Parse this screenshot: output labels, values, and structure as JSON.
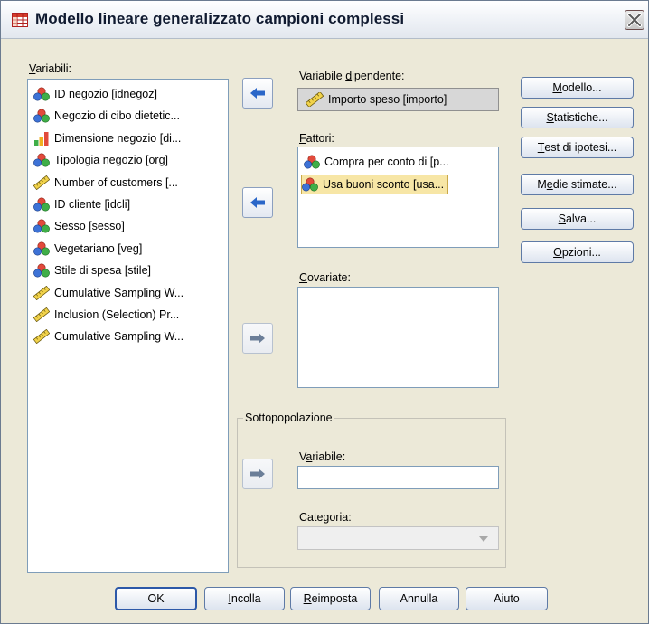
{
  "window": {
    "title": "Modello lineare generalizzato campioni complessi",
    "title_icon": "table-grid-icon",
    "close_icon": "close-icon"
  },
  "variables": {
    "label_u": "V",
    "label_rest": "ariabili:",
    "items": [
      {
        "label": "ID negozio [idnegoz]",
        "icon": "nominal-icon"
      },
      {
        "label": "Negozio di cibo dietetic...",
        "icon": "nominal-icon"
      },
      {
        "label": "Dimensione negozio [di...",
        "icon": "ordinal-icon"
      },
      {
        "label": "Tipologia negozio [org]",
        "icon": "nominal-icon"
      },
      {
        "label": "Number of customers [...",
        "icon": "scale-ruler-icon"
      },
      {
        "label": "ID cliente [idcli]",
        "icon": "nominal-icon"
      },
      {
        "label": "Sesso [sesso]",
        "icon": "nominal-icon"
      },
      {
        "label": "Vegetariano [veg]",
        "icon": "nominal-icon"
      },
      {
        "label": "Stile di spesa [stile]",
        "icon": "nominal-icon"
      },
      {
        "label": "Cumulative Sampling W...",
        "icon": "scale-ruler-icon"
      },
      {
        "label": "Inclusion (Selection) Pr...",
        "icon": "scale-ruler-icon"
      },
      {
        "label": "Cumulative Sampling W...",
        "icon": "scale-ruler-icon"
      }
    ]
  },
  "dependent": {
    "label_pre": "Variabile ",
    "label_u": "d",
    "label_post": "ipendente:",
    "value": "Importo speso [importo]",
    "icon": "scale-ruler-icon"
  },
  "factors": {
    "label_u": "F",
    "label_rest": "attori:",
    "items": [
      {
        "label": "Compra per conto di [p...",
        "icon": "nominal-icon",
        "selected": false
      },
      {
        "label": "Usa buoni sconto [usa...",
        "icon": "nominal-icon",
        "selected": true
      }
    ]
  },
  "covariates": {
    "label_u": "C",
    "label_rest": "ovariate:"
  },
  "subpopulation": {
    "legend": "Sottopopolazione",
    "variable_label_pre": "V",
    "variable_label_u": "a",
    "variable_label_post": "riabile:",
    "variable_value": "",
    "category_label_pre": "Cate",
    "category_label_u": "g",
    "category_label_post": "oria:",
    "category_value": ""
  },
  "side_buttons": [
    {
      "pre": "",
      "u": "M",
      "post": "odello..."
    },
    {
      "pre": "",
      "u": "S",
      "post": "tatistiche..."
    },
    {
      "pre": "",
      "u": "T",
      "post": "est di ipotesi..."
    },
    {
      "pre": "M",
      "u": "e",
      "post": "die stimate..."
    },
    {
      "pre": "",
      "u": "S",
      "post": "alva..."
    },
    {
      "pre": "",
      "u": "O",
      "post": "pzioni..."
    }
  ],
  "bottom_buttons": [
    {
      "pre": "",
      "u": "",
      "post": "OK"
    },
    {
      "pre": "",
      "u": "I",
      "post": "ncolla"
    },
    {
      "pre": "",
      "u": "R",
      "post": "eimposta"
    },
    {
      "pre": "",
      "u": "",
      "post": "Annulla"
    },
    {
      "pre": "",
      "u": "",
      "post": "Aiuto"
    }
  ],
  "colors": {
    "dialog_bg": "#ece9d8",
    "selection_bg": "#f7e6a6",
    "arrow_blue": "#2a66c8",
    "arrow_gray": "#6b7e98"
  }
}
